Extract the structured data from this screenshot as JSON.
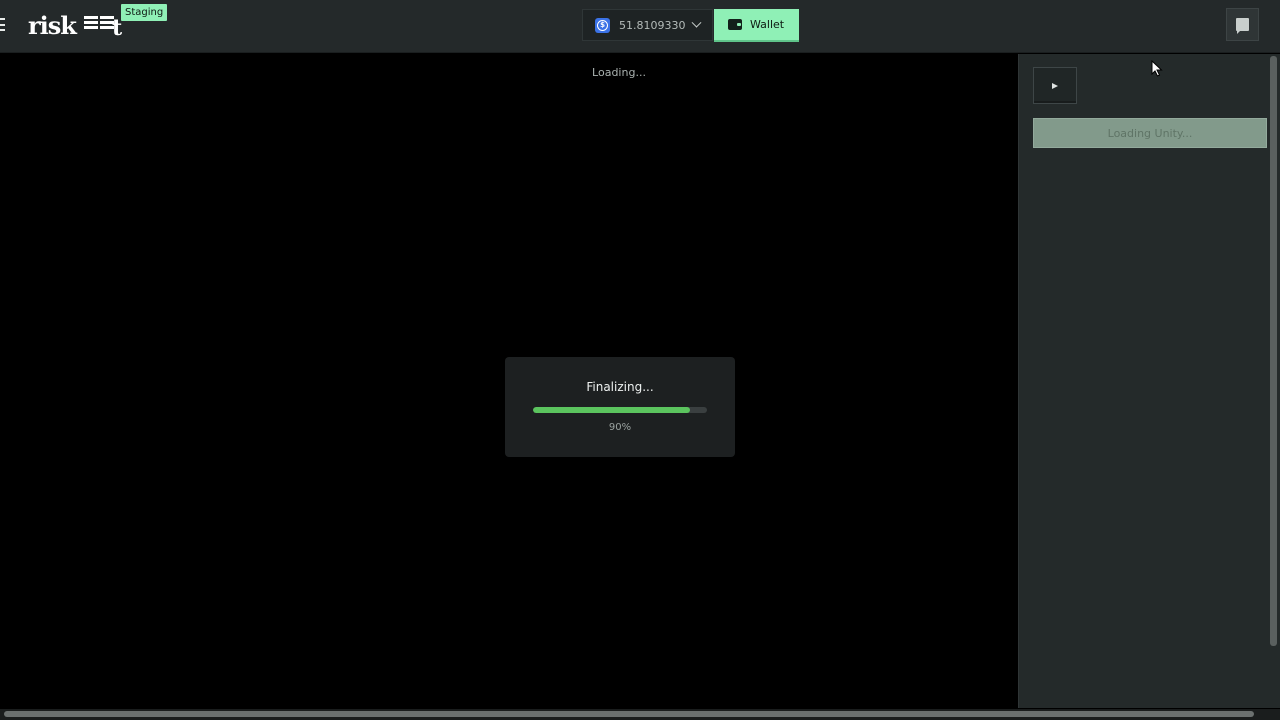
{
  "header": {
    "logo_text": "risk.it",
    "env_badge": "Staging",
    "balance": "51.8109330",
    "currency_icon": "usdc-icon",
    "wallet_label": "Wallet"
  },
  "game": {
    "status_text": "Loading...",
    "loader": {
      "title": "Finalizing...",
      "progress": 0.9,
      "percent_label": "90%"
    }
  },
  "sidebar": {
    "play_icon": "play-icon",
    "unity_status": "Loading Unity..."
  },
  "colors": {
    "accent": "#8ff0b6",
    "progress": "#5bc45e",
    "topbar_bg": "#24292a",
    "panel_bg": "#242a2a"
  }
}
